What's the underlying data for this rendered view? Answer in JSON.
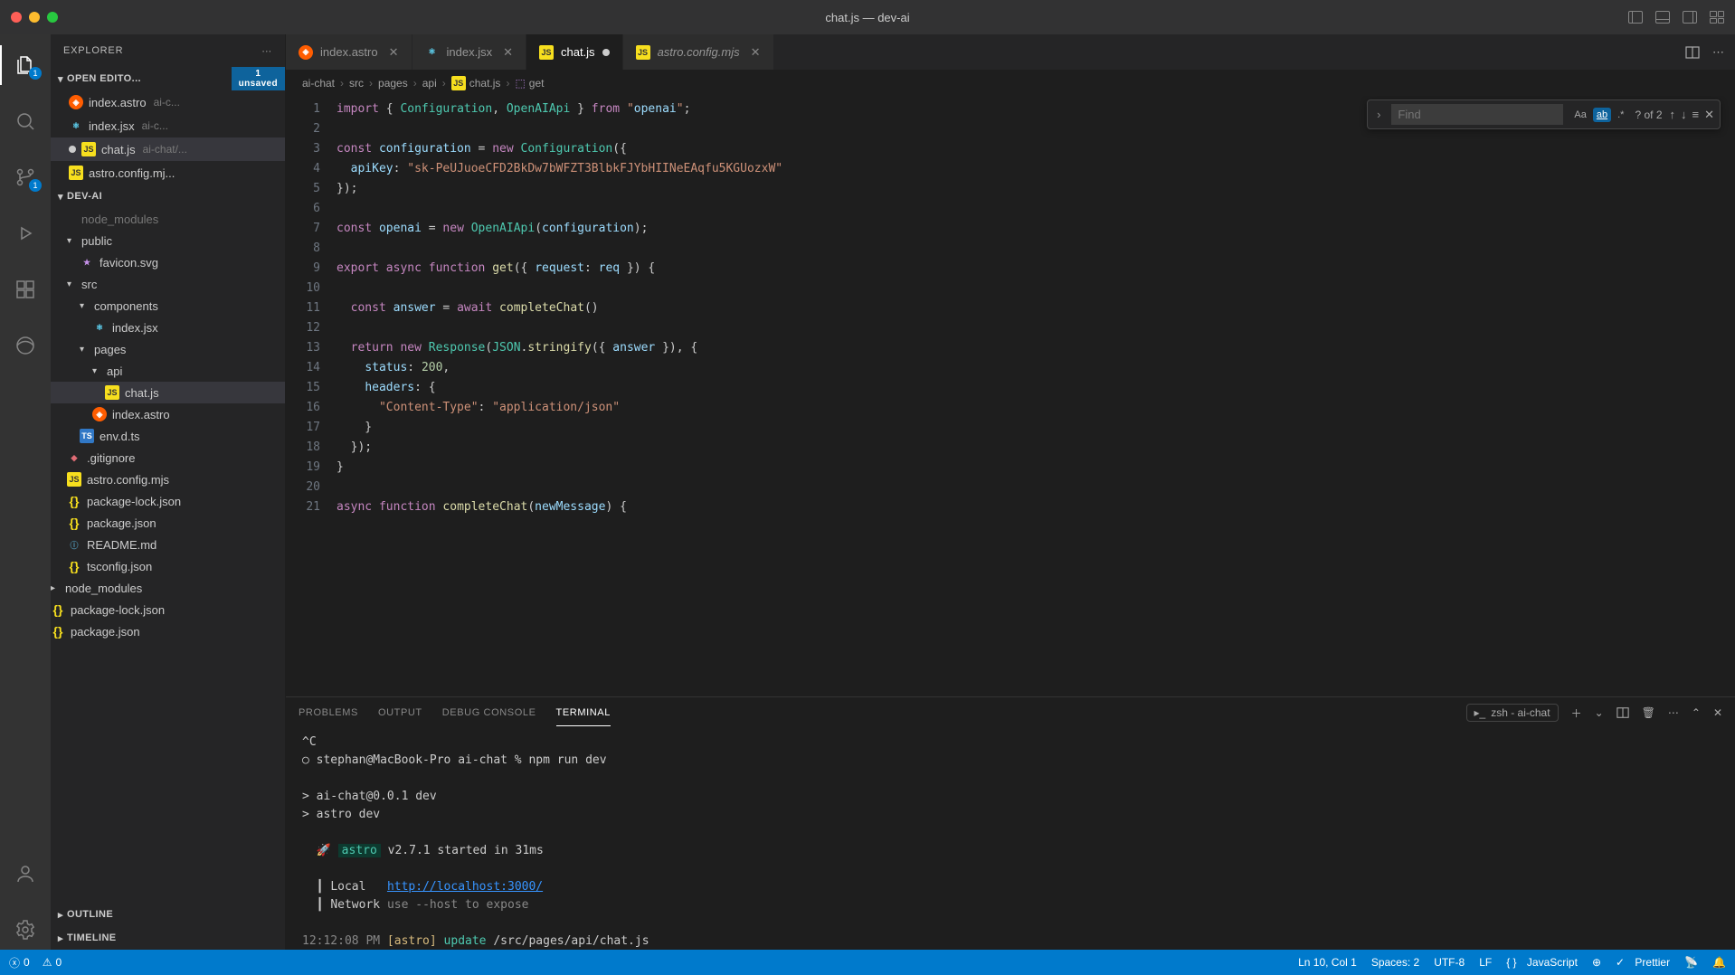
{
  "titlebar": {
    "title": "chat.js — dev-ai"
  },
  "activity": {
    "explorer_badge": "1",
    "scm_badge": "1"
  },
  "sidebar": {
    "title": "EXPLORER",
    "openEditors": {
      "label": "OPEN EDITO...",
      "unsaved_count": "1",
      "unsaved_label": "unsaved",
      "items": [
        {
          "name": "index.astro",
          "hint": "ai-c...",
          "icon": "astro"
        },
        {
          "name": "index.jsx",
          "hint": "ai-c...",
          "icon": "react"
        },
        {
          "name": "chat.js",
          "hint": "ai-chat/...",
          "icon": "js",
          "modified": true
        },
        {
          "name": "astro.config.mj...",
          "hint": "",
          "icon": "js"
        }
      ]
    },
    "project": {
      "name": "DEV-AI",
      "tree": [
        {
          "label": "node_modules",
          "depth": 1,
          "kind": "folder-dim",
          "chev": ""
        },
        {
          "label": "public",
          "depth": 1,
          "kind": "folder",
          "chev": "▾"
        },
        {
          "label": "favicon.svg",
          "depth": 2,
          "kind": "file",
          "icon": "fav"
        },
        {
          "label": "src",
          "depth": 1,
          "kind": "folder",
          "chev": "▾"
        },
        {
          "label": "components",
          "depth": 2,
          "kind": "folder",
          "chev": "▾"
        },
        {
          "label": "index.jsx",
          "depth": 3,
          "kind": "file",
          "icon": "react"
        },
        {
          "label": "pages",
          "depth": 2,
          "kind": "folder",
          "chev": "▾"
        },
        {
          "label": "api",
          "depth": 3,
          "kind": "folder",
          "chev": "▾"
        },
        {
          "label": "chat.js",
          "depth": 4,
          "kind": "file",
          "icon": "js",
          "selected": true
        },
        {
          "label": "index.astro",
          "depth": 3,
          "kind": "file",
          "icon": "astro"
        },
        {
          "label": "env.d.ts",
          "depth": 2,
          "kind": "file",
          "icon": "ts"
        },
        {
          "label": ".gitignore",
          "depth": 1,
          "kind": "file",
          "icon": "git"
        },
        {
          "label": "astro.config.mjs",
          "depth": 1,
          "kind": "file",
          "icon": "js"
        },
        {
          "label": "package-lock.json",
          "depth": 1,
          "kind": "file",
          "icon": "json"
        },
        {
          "label": "package.json",
          "depth": 1,
          "kind": "file",
          "icon": "json"
        },
        {
          "label": "README.md",
          "depth": 1,
          "kind": "file",
          "icon": "md"
        },
        {
          "label": "tsconfig.json",
          "depth": 1,
          "kind": "file",
          "icon": "json"
        },
        {
          "label": "node_modules",
          "depth": 0,
          "kind": "folder",
          "chev": "▸"
        },
        {
          "label": "package-lock.json",
          "depth": 0,
          "kind": "file",
          "icon": "json"
        },
        {
          "label": "package.json",
          "depth": 0,
          "kind": "file",
          "icon": "json"
        }
      ]
    },
    "outline": "OUTLINE",
    "timeline": "TIMELINE"
  },
  "tabs": [
    {
      "label": "index.astro",
      "icon": "astro"
    },
    {
      "label": "index.jsx",
      "icon": "react"
    },
    {
      "label": "chat.js",
      "icon": "js",
      "active": true,
      "modified": true
    },
    {
      "label": "astro.config.mjs",
      "icon": "js",
      "italic": true
    }
  ],
  "breadcrumb": {
    "parts": [
      "ai-chat",
      "src",
      "pages",
      "api",
      "chat.js",
      "get"
    ],
    "file_icon": "js"
  },
  "code": {
    "lines": [
      "import { Configuration, OpenAIApi } from \"openai\";",
      "",
      "const configuration = new Configuration({",
      "  apiKey: \"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\"",
      "});",
      "",
      "const openai = new OpenAIApi(configuration);",
      "",
      "export async function get({ request: req }) {",
      "",
      "  const answer = await completeChat()",
      "",
      "  return new Response(JSON.stringify({ answer }), {",
      "    status: 200,",
      "    headers: {",
      "      \"Content-Type\": \"application/json\"",
      "    }",
      "  });",
      "}",
      "",
      "async function completeChat(newMessage) {"
    ]
  },
  "find": {
    "placeholder": "Find",
    "count": "? of 2",
    "opts": {
      "case": "Aa",
      "word": "ab",
      "regex": ".*"
    }
  },
  "panel": {
    "tabs": [
      "PROBLEMS",
      "OUTPUT",
      "DEBUG CONSOLE",
      "TERMINAL"
    ],
    "active": 3,
    "launch": "zsh - ai-chat",
    "terminal": {
      "l1": "^C",
      "l2": "stephan@MacBook-Pro ai-chat % npm run dev",
      "l3": "> ai-chat@0.0.1 dev",
      "l4": "> astro dev",
      "l5_pre": "🚀 ",
      "l5_astro": "astro",
      "l5_rest": " v2.7.1 started in 31ms",
      "l6_label": "Local   ",
      "l6_link": "http://localhost:3000/",
      "l7_label": "Network ",
      "l7_rest": "use --host to expose",
      "l8_time": "12:12:08 PM ",
      "l8_tag": "[astro]",
      "l8_upd": " update ",
      "l8_path": "/src/pages/api/chat.js"
    }
  },
  "status": {
    "errors": "0",
    "warnings": "0",
    "cursor": "Ln 10, Col 1",
    "spaces": "Spaces: 2",
    "encoding": "UTF-8",
    "eol": "LF",
    "lang": "JavaScript",
    "prettier": "Prettier"
  }
}
